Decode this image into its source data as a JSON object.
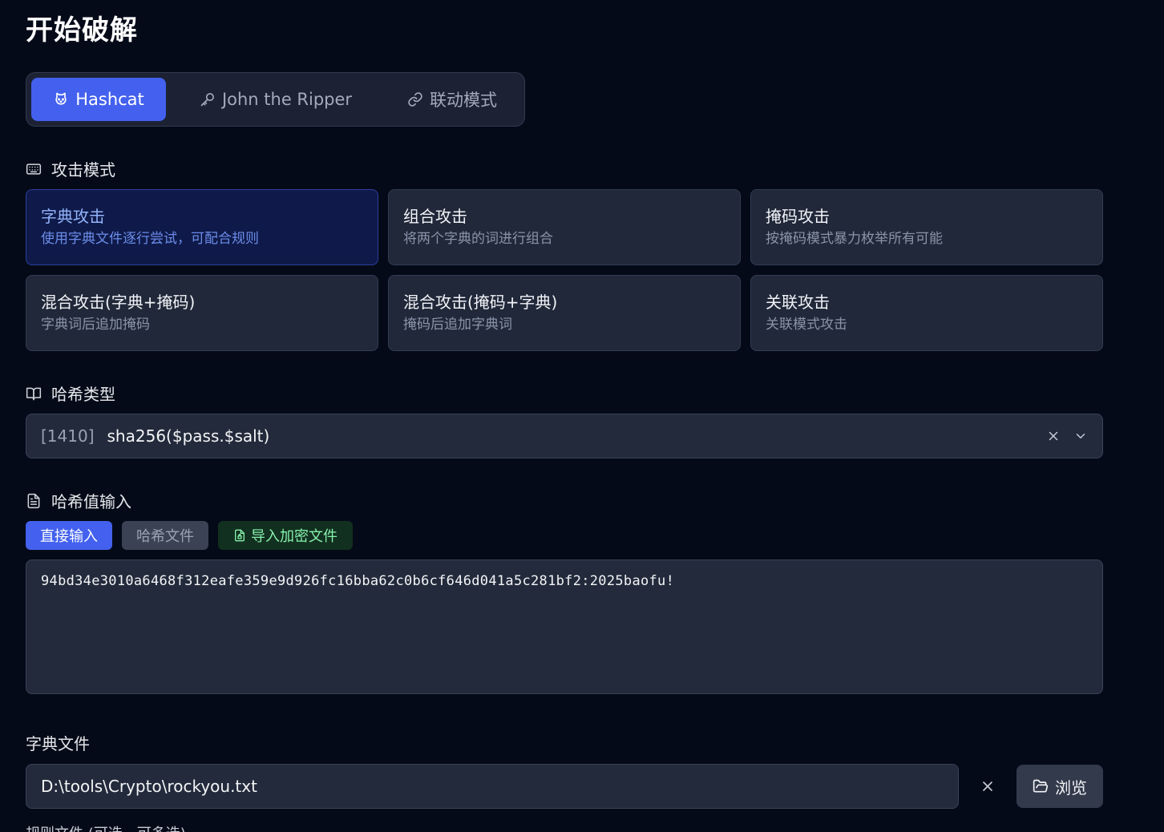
{
  "page": {
    "title": "开始破解"
  },
  "tool_tabs": [
    {
      "label": "Hashcat",
      "icon": "cat-icon",
      "active": true
    },
    {
      "label": "John the Ripper",
      "icon": "key-icon",
      "active": false
    },
    {
      "label": "联动模式",
      "icon": "link-icon",
      "active": false
    }
  ],
  "attack_mode": {
    "label": "攻击模式",
    "icon": "keyboard-icon",
    "modes": [
      {
        "title": "字典攻击",
        "desc": "使用字典文件逐行尝试，可配合规则",
        "active": true
      },
      {
        "title": "组合攻击",
        "desc": "将两个字典的词进行组合",
        "active": false
      },
      {
        "title": "掩码攻击",
        "desc": "按掩码模式暴力枚举所有可能",
        "active": false
      },
      {
        "title": "混合攻击(字典+掩码)",
        "desc": "字典词后追加掩码",
        "active": false
      },
      {
        "title": "混合攻击(掩码+字典)",
        "desc": "掩码后追加字典词",
        "active": false
      },
      {
        "title": "关联攻击",
        "desc": "关联模式攻击",
        "active": false
      }
    ]
  },
  "hash_type": {
    "label": "哈希类型",
    "icon": "book-open-icon",
    "code": "[1410]",
    "name": "sha256($pass.$salt)"
  },
  "hash_input": {
    "label": "哈希值输入",
    "icon": "file-text-icon",
    "modes": {
      "direct": "直接输入",
      "file": "哈希文件",
      "import": "导入加密文件"
    },
    "value": "94bd34e3010a6468f312eafe359e9d926fc16bba62c0b6cf646d041a5c281bf2:2025baofu!"
  },
  "dictionary": {
    "label": "字典文件",
    "value": "D:\\tools\\Crypto\\rockyou.txt",
    "browse_label": "浏览"
  },
  "rules": {
    "label": "规则文件 (可选，可多选)"
  },
  "colors": {
    "background": "#050a18",
    "accent": "#4361ee",
    "card": "#202839",
    "active_card": "#0f1a4a",
    "import_green": "#86efac"
  }
}
